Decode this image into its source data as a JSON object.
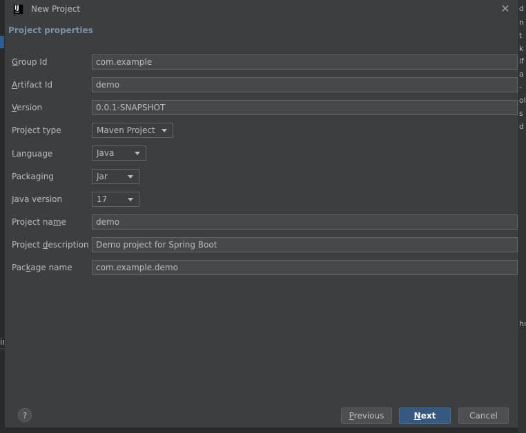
{
  "window": {
    "title": "New Project"
  },
  "section": {
    "header": "Project properties"
  },
  "fields": {
    "group_id": {
      "label_pre": "",
      "label_mnemonic": "G",
      "label_post": "roup Id",
      "value": "com.example"
    },
    "artifact_id": {
      "label_pre": "",
      "label_mnemonic": "A",
      "label_post": "rtifact Id",
      "value": "demo"
    },
    "version": {
      "label_pre": "",
      "label_mnemonic": "V",
      "label_post": "ersion",
      "value": "0.0.1-SNAPSHOT"
    },
    "project_type": {
      "label": "Project type",
      "value": "Maven Project"
    },
    "language": {
      "label": "Language",
      "value": "Java"
    },
    "packaging": {
      "label": "Packaging",
      "value": "Jar"
    },
    "java_version": {
      "label": "Java version",
      "value": "17"
    },
    "project_name": {
      "label_pre": "Project na",
      "label_mnemonic": "m",
      "label_post": "e",
      "value": "demo"
    },
    "project_description": {
      "label_pre": "Project ",
      "label_mnemonic": "d",
      "label_post": "escription",
      "value": "Demo project for Spring Boot"
    },
    "package_name": {
      "label_pre": "Pac",
      "label_mnemonic": "k",
      "label_post": "age name",
      "value": "com.example.demo"
    }
  },
  "buttons": {
    "help": "?",
    "previous": {
      "mnemonic": "P",
      "rest": "revious"
    },
    "next": {
      "mnemonic": "N",
      "rest": "ext"
    },
    "cancel": "Cancel"
  },
  "background": {
    "right_fragments": [
      "d",
      "n",
      "t",
      "k",
      "if",
      "a",
      "-",
      "ol",
      "s",
      "d",
      "hu"
    ],
    "left_fragment": "ir"
  }
}
